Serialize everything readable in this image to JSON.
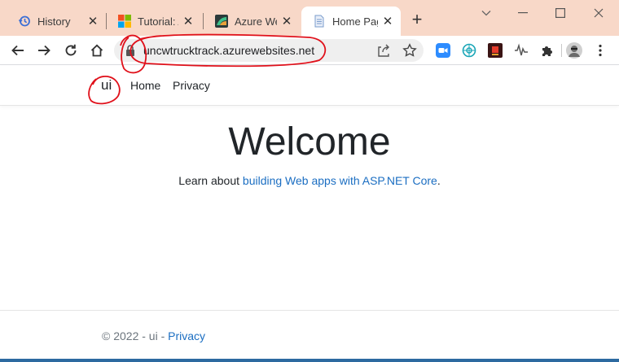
{
  "browser": {
    "tabs": [
      {
        "title": "History",
        "icon": "history-icon",
        "active": false
      },
      {
        "title": "Tutorial: A",
        "icon": "microsoft-logo-icon",
        "active": false
      },
      {
        "title": "Azure Web",
        "icon": "azure-app-service-icon",
        "active": false
      },
      {
        "title": "Home Pag",
        "icon": "document-icon",
        "active": true
      }
    ],
    "new_tab_label": "+",
    "address": {
      "url": "uncwtrucktrack.azurewebsites.net"
    },
    "extensions": [
      "zoom-icon",
      "extension-teal-icon",
      "extension-red-icon",
      "extension-wave-icon",
      "puzzle-icon"
    ],
    "accent_colors": {
      "tabstrip": "#f8d8c8",
      "link": "#1b6ec2",
      "annotation": "#e0101a"
    }
  },
  "site": {
    "brand": "ui",
    "nav": [
      {
        "label": "Home"
      },
      {
        "label": "Privacy"
      }
    ],
    "heading": "Welcome",
    "lead_prefix": "Learn about ",
    "lead_link": "building Web apps with ASP.NET Core",
    "lead_suffix": ".",
    "footer_prefix": "© 2022 - ui - ",
    "footer_link": "Privacy"
  }
}
